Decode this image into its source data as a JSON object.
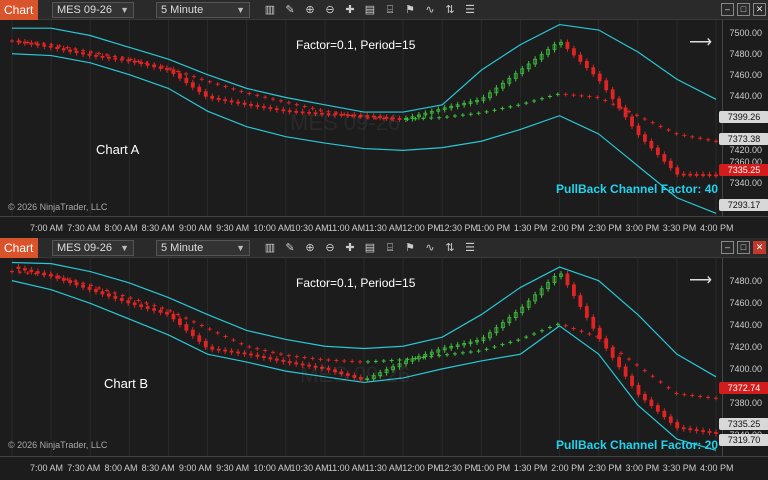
{
  "colors": {
    "up": "#3fbf3f",
    "down": "#e02424",
    "channel": "#29c7d6",
    "accent": "#d9532b"
  },
  "windows": [
    {
      "tab": "Chart",
      "instrument": "MES 09-26",
      "interval": "5 Minute",
      "factor_text": "Factor=0.1, Period=15",
      "chart_name": "Chart A",
      "pullback_text": "PullBack Channel Factor: 40",
      "copyright": "© 2026 NinjaTrader, LLC",
      "watermark": "MES 09-26",
      "price_ticks": [
        "7500.00",
        "7480.00",
        "7460.00",
        "7440.00",
        "7420.00",
        "7360.00",
        "7340.00",
        "7320.00"
      ],
      "price_labels": {
        "upper": "7399.26",
        "mid": "7373.38",
        "last": "7335.25",
        "lower": "7293.17"
      },
      "time_ticks": [
        "7:00 AM",
        "7:30 AM",
        "8:00 AM",
        "8:30 AM",
        "9:00 AM",
        "9:30 AM",
        "10:00 AM",
        "10:30 AM",
        "11:00 AM",
        "11:30 AM",
        "12:00 PM",
        "12:30 PM",
        "1:00 PM",
        "1:30 PM",
        "2:00 PM",
        "2:30 PM",
        "3:00 PM",
        "3:30 PM",
        "4:00 PM"
      ]
    },
    {
      "tab": "Chart",
      "instrument": "MES 09-26",
      "interval": "5 Minute",
      "factor_text": "Factor=0.1, Period=15",
      "chart_name": "Chart B",
      "pullback_text": "PullBack Channel Factor: 20",
      "copyright": "© 2026 NinjaTrader, LLC",
      "watermark": "MES 09-26",
      "price_ticks": [
        "7480.00",
        "7460.00",
        "7440.00",
        "7420.00",
        "7400.00",
        "7380.00",
        "7340.00"
      ],
      "price_labels": {
        "upper": "7372.74",
        "last": "7335.25",
        "lower": "7319.70"
      },
      "time_ticks": [
        "7:00 AM",
        "7:30 AM",
        "8:00 AM",
        "8:30 AM",
        "9:00 AM",
        "9:30 AM",
        "10:00 AM",
        "10:30 AM",
        "11:00 AM",
        "11:30 AM",
        "12:00 PM",
        "12:30 PM",
        "1:00 PM",
        "1:30 PM",
        "2:00 PM",
        "2:30 PM",
        "3:00 PM",
        "3:30 PM",
        "4:00 PM"
      ]
    }
  ],
  "toolbar_icons": [
    "bar-type-icon",
    "draw-icon",
    "zoom-in-icon",
    "zoom-out-icon",
    "crosshair-icon",
    "properties-icon",
    "templates-icon",
    "strategies-icon",
    "indicators-icon",
    "chart-trader-icon",
    "data-box-icon"
  ],
  "chart_data": [
    {
      "type": "line",
      "title": "Factor=0.1, Period=15",
      "y_range": [
        7290,
        7505
      ],
      "x": [
        "7:00 AM",
        "7:30 AM",
        "8:00 AM",
        "8:30 AM",
        "9:00 AM",
        "9:30 AM",
        "10:00 AM",
        "10:30 AM",
        "11:00 AM",
        "11:30 AM",
        "12:00 PM",
        "12:30 PM",
        "1:00 PM",
        "1:30 PM",
        "2:00 PM",
        "2:30 PM",
        "3:00 PM",
        "3:30 PM",
        "4:00 PM"
      ],
      "series": [
        {
          "name": "upper",
          "values": [
            7496,
            7496,
            7488,
            7475,
            7462,
            7445,
            7430,
            7420,
            7412,
            7404,
            7404,
            7412,
            7450,
            7478,
            7500,
            7494,
            7470,
            7440,
            7418
          ]
        },
        {
          "name": "middle",
          "values": [
            7482,
            7478,
            7470,
            7462,
            7452,
            7438,
            7425,
            7415,
            7405,
            7398,
            7396,
            7398,
            7403,
            7412,
            7424,
            7420,
            7400,
            7380,
            7372
          ]
        },
        {
          "name": "lower",
          "values": [
            7468,
            7466,
            7458,
            7445,
            7430,
            7405,
            7388,
            7377,
            7370,
            7364,
            7362,
            7365,
            7372,
            7385,
            7400,
            7380,
            7345,
            7310,
            7293
          ]
        },
        {
          "name": "close",
          "values": [
            7482,
            7475,
            7466,
            7460,
            7450,
            7420,
            7412,
            7405,
            7402,
            7400,
            7396,
            7408,
            7418,
            7450,
            7482,
            7440,
            7380,
            7336,
            7335
          ]
        }
      ]
    },
    {
      "type": "line",
      "title": "Factor=0.1, Period=15",
      "y_range": [
        7315,
        7490
      ],
      "x": [
        "7:00 AM",
        "7:30 AM",
        "8:00 AM",
        "8:30 AM",
        "9:00 AM",
        "9:30 AM",
        "10:00 AM",
        "10:30 AM",
        "11:00 AM",
        "11:30 AM",
        "12:00 PM",
        "12:30 PM",
        "1:00 PM",
        "1:30 PM",
        "2:00 PM",
        "2:30 PM",
        "3:00 PM",
        "3:30 PM",
        "4:00 PM"
      ],
      "series": [
        {
          "name": "upper",
          "values": [
            7486,
            7485,
            7478,
            7468,
            7455,
            7440,
            7426,
            7418,
            7412,
            7410,
            7412,
            7420,
            7440,
            7464,
            7482,
            7470,
            7440,
            7405,
            7385
          ]
        },
        {
          "name": "middle",
          "values": [
            7478,
            7475,
            7466,
            7455,
            7444,
            7428,
            7412,
            7404,
            7400,
            7398,
            7400,
            7404,
            7408,
            7418,
            7432,
            7420,
            7395,
            7370,
            7366
          ]
        },
        {
          "name": "lower",
          "values": [
            7470,
            7462,
            7450,
            7436,
            7422,
            7405,
            7398,
            7390,
            7385,
            7380,
            7384,
            7392,
            7399,
            7405,
            7430,
            7405,
            7360,
            7330,
            7320
          ]
        },
        {
          "name": "close",
          "values": [
            7482,
            7474,
            7462,
            7450,
            7440,
            7410,
            7405,
            7398,
            7392,
            7382,
            7398,
            7410,
            7418,
            7445,
            7478,
            7420,
            7370,
            7340,
            7335
          ]
        }
      ]
    }
  ]
}
